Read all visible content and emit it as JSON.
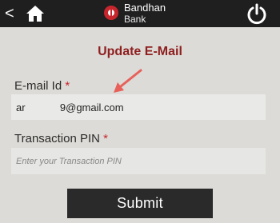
{
  "header": {
    "back_glyph": "<",
    "brand_name_line1": "Bandhan",
    "brand_name_line2": "Bank",
    "brand_color": "#c8262d",
    "icons": [
      "back-icon",
      "home-icon",
      "bandhan-logo-icon",
      "power-icon"
    ]
  },
  "page": {
    "title": "Update E-Mail",
    "title_color": "#8e1f1f"
  },
  "form": {
    "email_label": "E-mail Id",
    "email_required": "*",
    "email_value": "ar            9@gmail.com",
    "pin_label": "Transaction PIN",
    "pin_required": "*",
    "pin_placeholder": "Enter your Transaction PIN",
    "required_color": "#c8262d"
  },
  "annotation": {
    "arrow_color": "#e8605a"
  },
  "actions": {
    "submit_label": "Submit"
  }
}
